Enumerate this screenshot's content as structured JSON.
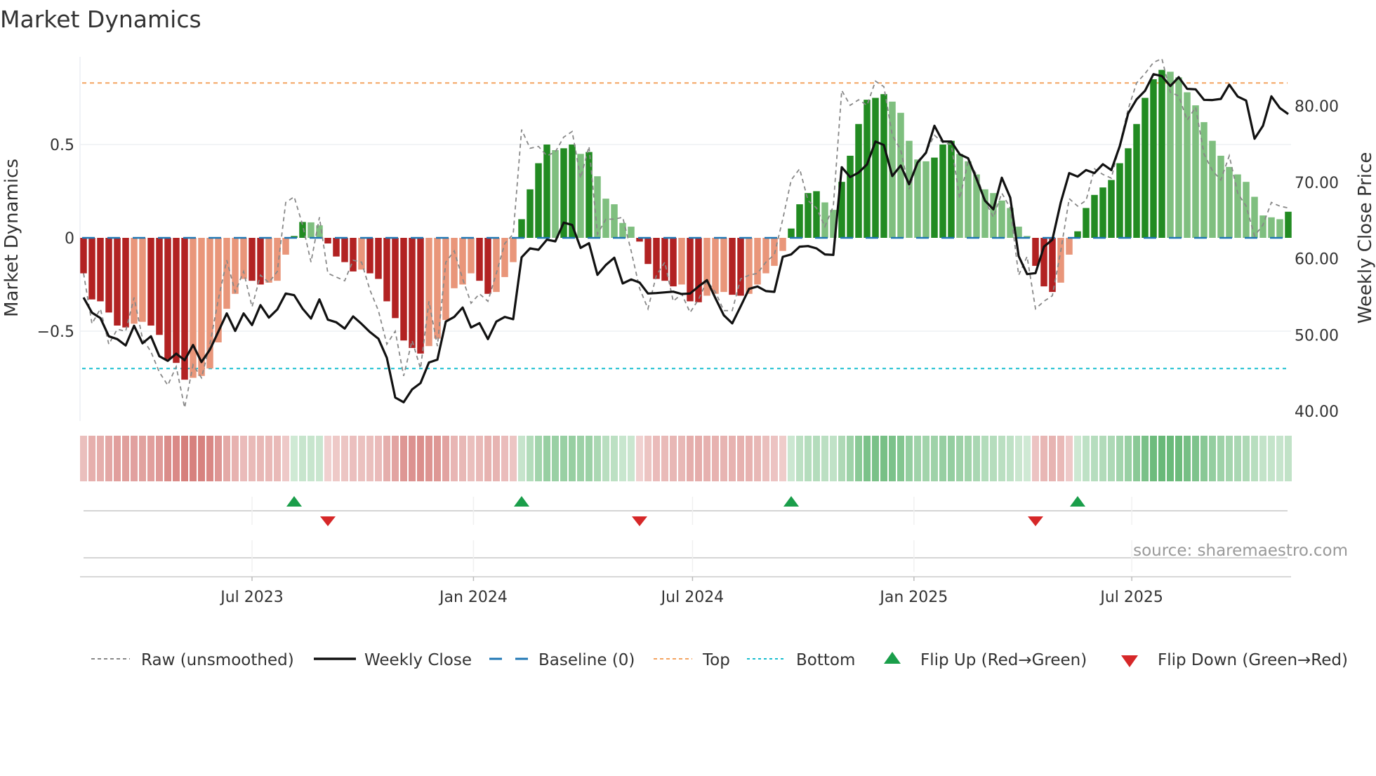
{
  "title": "Market Dynamics",
  "source": "source: sharemaestro.com",
  "chart_data": {
    "type": "bar",
    "title": "Market Dynamics",
    "ylabel": "Market Dynamics",
    "y2label": "Weekly Close Price",
    "ylim": [
      -0.98,
      0.97
    ],
    "y2lim": [
      38.7,
      86.4
    ],
    "yticks": [
      {
        "v": 0.5,
        "label": "0.5"
      },
      {
        "v": 0,
        "label": "0"
      },
      {
        "v": -0.5,
        "label": "−0.5"
      }
    ],
    "y2ticks": [
      {
        "v": 80,
        "label": "80.00"
      },
      {
        "v": 70,
        "label": "70.00"
      },
      {
        "v": 60,
        "label": "60.00"
      },
      {
        "v": 50,
        "label": "50.00"
      },
      {
        "v": 40,
        "label": "40.00"
      }
    ],
    "xticks": [
      {
        "date": "2023-07-01",
        "label": "Jul 2023"
      },
      {
        "date": "2024-01-01",
        "label": "Jan 2024"
      },
      {
        "date": "2024-07-01",
        "label": "Jul 2024"
      },
      {
        "date": "2025-01-01",
        "label": "Jan 2025"
      },
      {
        "date": "2025-07-01",
        "label": "Jul 2025"
      }
    ],
    "start_date": "2023-02-11",
    "frequency": "weekly",
    "top_threshold": 0.83,
    "bottom_threshold": -0.7,
    "baseline": 0,
    "smoothed": [
      -0.19,
      -0.33,
      -0.34,
      -0.4,
      -0.47,
      -0.48,
      -0.46,
      -0.45,
      -0.47,
      -0.52,
      -0.65,
      -0.67,
      -0.76,
      -0.75,
      -0.74,
      -0.7,
      -0.56,
      -0.38,
      -0.3,
      -0.22,
      -0.23,
      -0.25,
      -0.24,
      -0.23,
      -0.09,
      0.01,
      0.085,
      0.083,
      0.067,
      -0.03,
      -0.1,
      -0.13,
      -0.18,
      -0.17,
      -0.19,
      -0.22,
      -0.34,
      -0.43,
      -0.55,
      -0.59,
      -0.62,
      -0.58,
      -0.54,
      -0.44,
      -0.27,
      -0.25,
      -0.19,
      -0.23,
      -0.3,
      -0.29,
      -0.21,
      -0.13,
      0.1,
      0.26,
      0.4,
      0.5,
      0.47,
      0.48,
      0.5,
      0.45,
      0.46,
      0.33,
      0.21,
      0.18,
      0.08,
      0.06,
      -0.02,
      -0.14,
      -0.22,
      -0.23,
      -0.26,
      -0.25,
      -0.34,
      -0.345,
      -0.31,
      -0.3,
      -0.29,
      -0.305,
      -0.31,
      -0.3,
      -0.25,
      -0.19,
      -0.15,
      -0.07,
      0.05,
      0.18,
      0.24,
      0.25,
      0.19,
      0.15,
      0.3,
      0.44,
      0.61,
      0.74,
      0.75,
      0.77,
      0.73,
      0.67,
      0.52,
      0.42,
      0.41,
      0.43,
      0.5,
      0.52,
      0.45,
      0.41,
      0.34,
      0.26,
      0.24,
      0.2,
      0.16,
      0.06,
      0.01,
      -0.15,
      -0.26,
      -0.29,
      -0.24,
      -0.09,
      0.035,
      0.16,
      0.23,
      0.27,
      0.31,
      0.4,
      0.48,
      0.61,
      0.75,
      0.85,
      0.9,
      0.89,
      0.86,
      0.78,
      0.71,
      0.62,
      0.52,
      0.44,
      0.38,
      0.34,
      0.3,
      0.22,
      0.12,
      0.11,
      0.1,
      0.14
    ],
    "raw": [
      -0.19,
      -0.46,
      -0.38,
      -0.57,
      -0.49,
      -0.5,
      -0.32,
      -0.54,
      -0.61,
      -0.72,
      -0.79,
      -0.69,
      -0.91,
      -0.68,
      -0.75,
      -0.57,
      -0.33,
      -0.12,
      -0.29,
      -0.18,
      -0.37,
      -0.2,
      -0.24,
      -0.18,
      0.19,
      0.22,
      0.07,
      -0.13,
      0.11,
      -0.19,
      -0.21,
      -0.23,
      -0.12,
      -0.13,
      -0.28,
      -0.39,
      -0.57,
      -0.5,
      -0.74,
      -0.55,
      -0.7,
      -0.34,
      -0.58,
      -0.13,
      -0.07,
      -0.22,
      -0.35,
      -0.3,
      -0.34,
      -0.19,
      -0.03,
      0.02,
      0.58,
      0.48,
      0.49,
      0.44,
      0.46,
      0.54,
      0.57,
      0.32,
      0.49,
      0.02,
      0.1,
      0.1,
      0.11,
      -0.07,
      -0.27,
      -0.38,
      -0.2,
      -0.13,
      -0.34,
      -0.3,
      -0.4,
      -0.33,
      -0.23,
      -0.29,
      -0.39,
      -0.39,
      -0.22,
      -0.2,
      -0.19,
      -0.13,
      -0.09,
      0.1,
      0.31,
      0.37,
      0.2,
      0.16,
      0.06,
      0.17,
      0.79,
      0.71,
      0.74,
      0.71,
      0.84,
      0.81,
      0.55,
      0.47,
      0.26,
      0.41,
      0.46,
      0.55,
      0.51,
      0.5,
      0.21,
      0.41,
      0.34,
      0.2,
      0.11,
      0.24,
      0.16,
      -0.2,
      -0.1,
      -0.38,
      -0.34,
      -0.31,
      -0.07,
      0.21,
      0.17,
      0.2,
      0.37,
      0.34,
      0.32,
      0.5,
      0.69,
      0.83,
      0.88,
      0.94,
      0.96,
      0.78,
      0.76,
      0.63,
      0.7,
      0.45,
      0.36,
      0.31,
      0.44,
      0.24,
      0.17,
      0.01,
      0.07,
      0.19,
      0.17,
      0.16
    ],
    "close": [
      54.9,
      52.91,
      52.2,
      49.81,
      49.44,
      48.61,
      51.19,
      48.89,
      49.81,
      47.2,
      46.59,
      47.54,
      46.68,
      48.67,
      46.44,
      48.06,
      50.42,
      52.81,
      50.51,
      52.81,
      51.28,
      53.89,
      52.26,
      53.33,
      55.42,
      55.2,
      53.43,
      52.14,
      54.65,
      51.99,
      51.65,
      50.82,
      52.42,
      51.44,
      50.36,
      49.5,
      47.0,
      41.78,
      41.17,
      42.85,
      43.68,
      46.38,
      46.75,
      51.74,
      52.35,
      53.58,
      50.97,
      51.53,
      49.44,
      51.74,
      52.35,
      52.05,
      60.17,
      61.33,
      61.15,
      62.47,
      62.25,
      64.71,
      64.4,
      61.4,
      62.01,
      57.87,
      59.16,
      60.11,
      56.74,
      57.26,
      56.86,
      55.42,
      55.48,
      55.57,
      55.66,
      55.36,
      55.42,
      56.34,
      57.17,
      54.81,
      52.57,
      51.5,
      53.73,
      56.03,
      56.34,
      55.73,
      55.63,
      60.23,
      60.54,
      61.55,
      61.64,
      61.33,
      60.54,
      60.48,
      71.97,
      70.68,
      71.26,
      72.34,
      75.34,
      74.88,
      70.81,
      72.19,
      69.73,
      72.58,
      73.87,
      77.4,
      75.34,
      75.34,
      73.66,
      73.14,
      70.44,
      67.59,
      66.45,
      70.59,
      67.99,
      60.32,
      57.96,
      58.09,
      61.55,
      62.47,
      67.37,
      71.2,
      70.74,
      71.6,
      71.2,
      72.37,
      71.6,
      74.73,
      79.02,
      80.86,
      81.99,
      84.17,
      83.92,
      82.61,
      83.77,
      82.24,
      82.18,
      80.8,
      80.77,
      80.92,
      82.79,
      81.23,
      80.71,
      75.71,
      77.4,
      81.26,
      79.73,
      78.93
    ],
    "flip_up_weeks": [
      26,
      53,
      85,
      119
    ],
    "flip_down_weeks": [
      30,
      67,
      114
    ],
    "legend": {
      "placement": "bottom",
      "raw": "Raw (unsmoothed)",
      "close": "Weekly Close",
      "baseline": "Baseline (0)",
      "top": "Top",
      "bottom": "Bottom",
      "flip_up": "Flip Up (Red→Green)",
      "flip_down": "Flip Down (Green→Red)"
    },
    "colors": {
      "red_strong": "#b22222",
      "red_weak": "#e9967a",
      "green_strong": "#228b22",
      "green_weak": "#7fbf7f",
      "baseline": "#1f77b4",
      "top": "#f4a460",
      "bottom": "#17becf",
      "flip_up": "#1a9e4a",
      "flip_down": "#d62728",
      "close": "#111111",
      "raw": "#888888"
    }
  }
}
